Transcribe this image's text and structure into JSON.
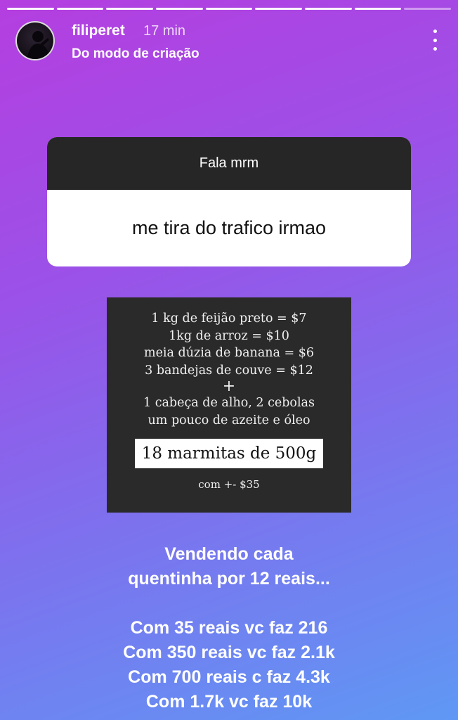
{
  "story": {
    "progress_segments": 9
  },
  "header": {
    "username": "filiperet",
    "time": "17 min",
    "subtitle": "Do modo de criação",
    "more_icon": "vertical-ellipsis-icon"
  },
  "question": {
    "prompt": "Fala mrm",
    "answer": "me tira do trafico irmao"
  },
  "recipe": {
    "lines": [
      "1 kg de feijão preto = $7",
      "1kg de arroz = $10",
      "meia dúzia de banana = $6",
      "3 bandejas de couve = $12"
    ],
    "plus": "+",
    "extras": [
      "1 cabeça de alho, 2 cebolas",
      "um pouco de azeite e óleo"
    ],
    "highlight": "18 marmitas de 500g",
    "total": "com +- $35"
  },
  "caption": {
    "intro": [
      "Vendendo cada",
      "quentinha por 12 reais..."
    ],
    "results": [
      "Com 35 reais vc faz 216",
      "Com 350 reais vc faz 2.1k",
      "Com 700 reais c faz 4.3k",
      "Com 1.7k vc faz 10k"
    ]
  }
}
